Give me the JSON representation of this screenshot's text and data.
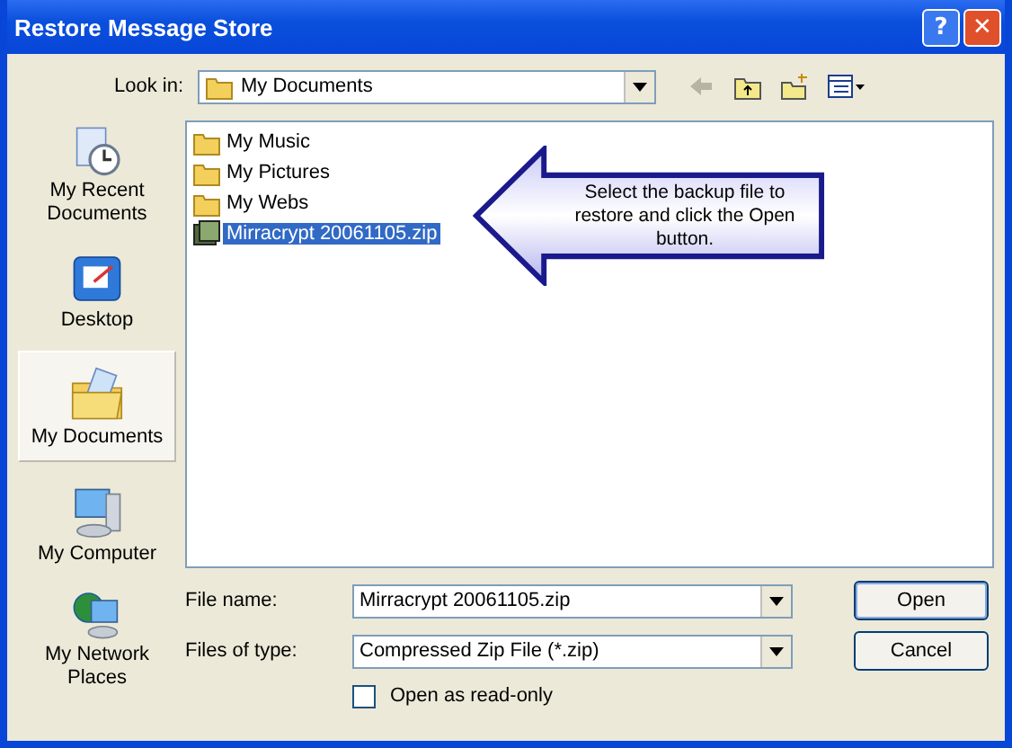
{
  "window": {
    "title": "Restore Message Store",
    "buttons": [
      "?",
      "✕"
    ]
  },
  "look_in": {
    "label": "Look in:",
    "value": "My Documents"
  },
  "places": [
    {
      "label": "My Recent Documents",
      "kind": "recent",
      "selected": false
    },
    {
      "label": "Desktop",
      "kind": "desktop",
      "selected": false
    },
    {
      "label": "My Documents",
      "kind": "documents",
      "selected": true
    },
    {
      "label": "My Computer",
      "kind": "computer",
      "selected": false
    },
    {
      "label": "My Network Places",
      "kind": "network",
      "selected": false
    }
  ],
  "files": [
    {
      "name": "My Music",
      "kind": "folder",
      "selected": false
    },
    {
      "name": "My Pictures",
      "kind": "folder",
      "selected": false
    },
    {
      "name": "My Webs",
      "kind": "folder",
      "selected": false
    },
    {
      "name": "Mirracrypt 20061105.zip",
      "kind": "zip",
      "selected": true
    }
  ],
  "callout": "Select the backup file to restore and click the Open button.",
  "file_name": {
    "label": "File name:",
    "value": "Mirracrypt 20061105.zip"
  },
  "file_type": {
    "label": "Files of type:",
    "value": "Compressed Zip File (*.zip)"
  },
  "read_only": {
    "label": "Open as read-only",
    "checked": false
  },
  "buttons": [
    "Open",
    "Cancel"
  ]
}
